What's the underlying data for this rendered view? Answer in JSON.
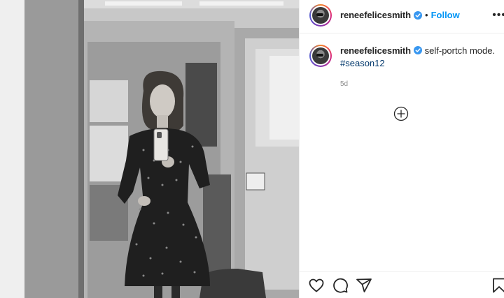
{
  "photo": {
    "description_icon": "photo-icon"
  },
  "header": {
    "username": "reneefelicesmith",
    "separator": "•",
    "follow_label": "Follow",
    "more_icon": "more-options-icon"
  },
  "caption": {
    "username": "reneefelicesmith",
    "text": "self-portch mode.",
    "hashtag": "#season12",
    "age": "5d"
  },
  "icons": {
    "verified": "verified-badge-icon",
    "load_more": "plus-circle-icon",
    "like": "heart-icon",
    "comment": "comment-icon",
    "share": "share-icon",
    "save": "bookmark-icon"
  },
  "colors": {
    "accent": "#0095f6",
    "hashtag": "#00376b",
    "text": "#262626",
    "muted": "#8e8e8e"
  }
}
